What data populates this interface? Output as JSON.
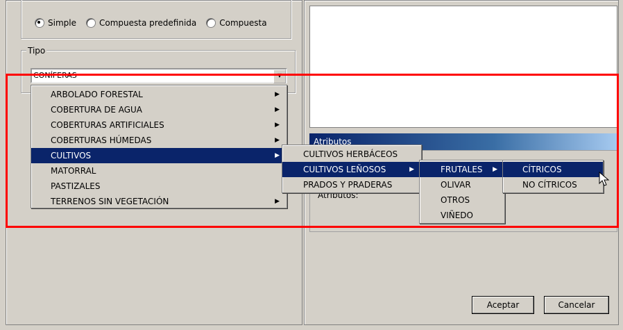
{
  "mode": {
    "options": [
      {
        "label": "Simple",
        "selected": true
      },
      {
        "label": "Compuesta predefinida",
        "selected": false
      },
      {
        "label": "Compuesta",
        "selected": false
      }
    ]
  },
  "tipo": {
    "legend": "Tipo",
    "combo_value": "CONÍFERAS"
  },
  "menu_level1": [
    {
      "label": "ARBOLADO FORESTAL",
      "submenu": true
    },
    {
      "label": "COBERTURA DE AGUA",
      "submenu": true
    },
    {
      "label": "COBERTURAS ARTIFICIALES",
      "submenu": true
    },
    {
      "label": "COBERTURAS HÚMEDAS",
      "submenu": true
    },
    {
      "label": "CULTIVOS",
      "submenu": true,
      "selected": true
    },
    {
      "label": "MATORRAL",
      "submenu": false
    },
    {
      "label": "PASTIZALES",
      "submenu": false
    },
    {
      "label": "TERRENOS SIN VEGETACIÓN",
      "submenu": true
    }
  ],
  "menu_level2": [
    {
      "label": "CULTIVOS HERBÁCEOS",
      "submenu": false
    },
    {
      "label": "CULTIVOS LEÑOSOS",
      "submenu": true,
      "selected": true
    },
    {
      "label": "PRADOS Y PRADERAS",
      "submenu": false
    }
  ],
  "menu_level3": [
    {
      "label": "FRUTALES",
      "submenu": true,
      "selected": true
    },
    {
      "label": "OLIVAR",
      "submenu": false
    },
    {
      "label": "OTROS",
      "submenu": false
    },
    {
      "label": "VIÑEDO",
      "submenu": false
    }
  ],
  "menu_level4": [
    {
      "label": "CÍTRICOS",
      "selected": true
    },
    {
      "label": "NO CÍTRICOS",
      "selected": false
    }
  ],
  "atributos": {
    "title": "Atributos",
    "field_label": "Atributos:"
  },
  "buttons": {
    "accept": "Aceptar",
    "cancel": "Cancelar"
  },
  "colors": {
    "menu_highlight": "#0a246a",
    "window_bg": "#d4d0c8",
    "annotation_frame": "#ff0000"
  }
}
